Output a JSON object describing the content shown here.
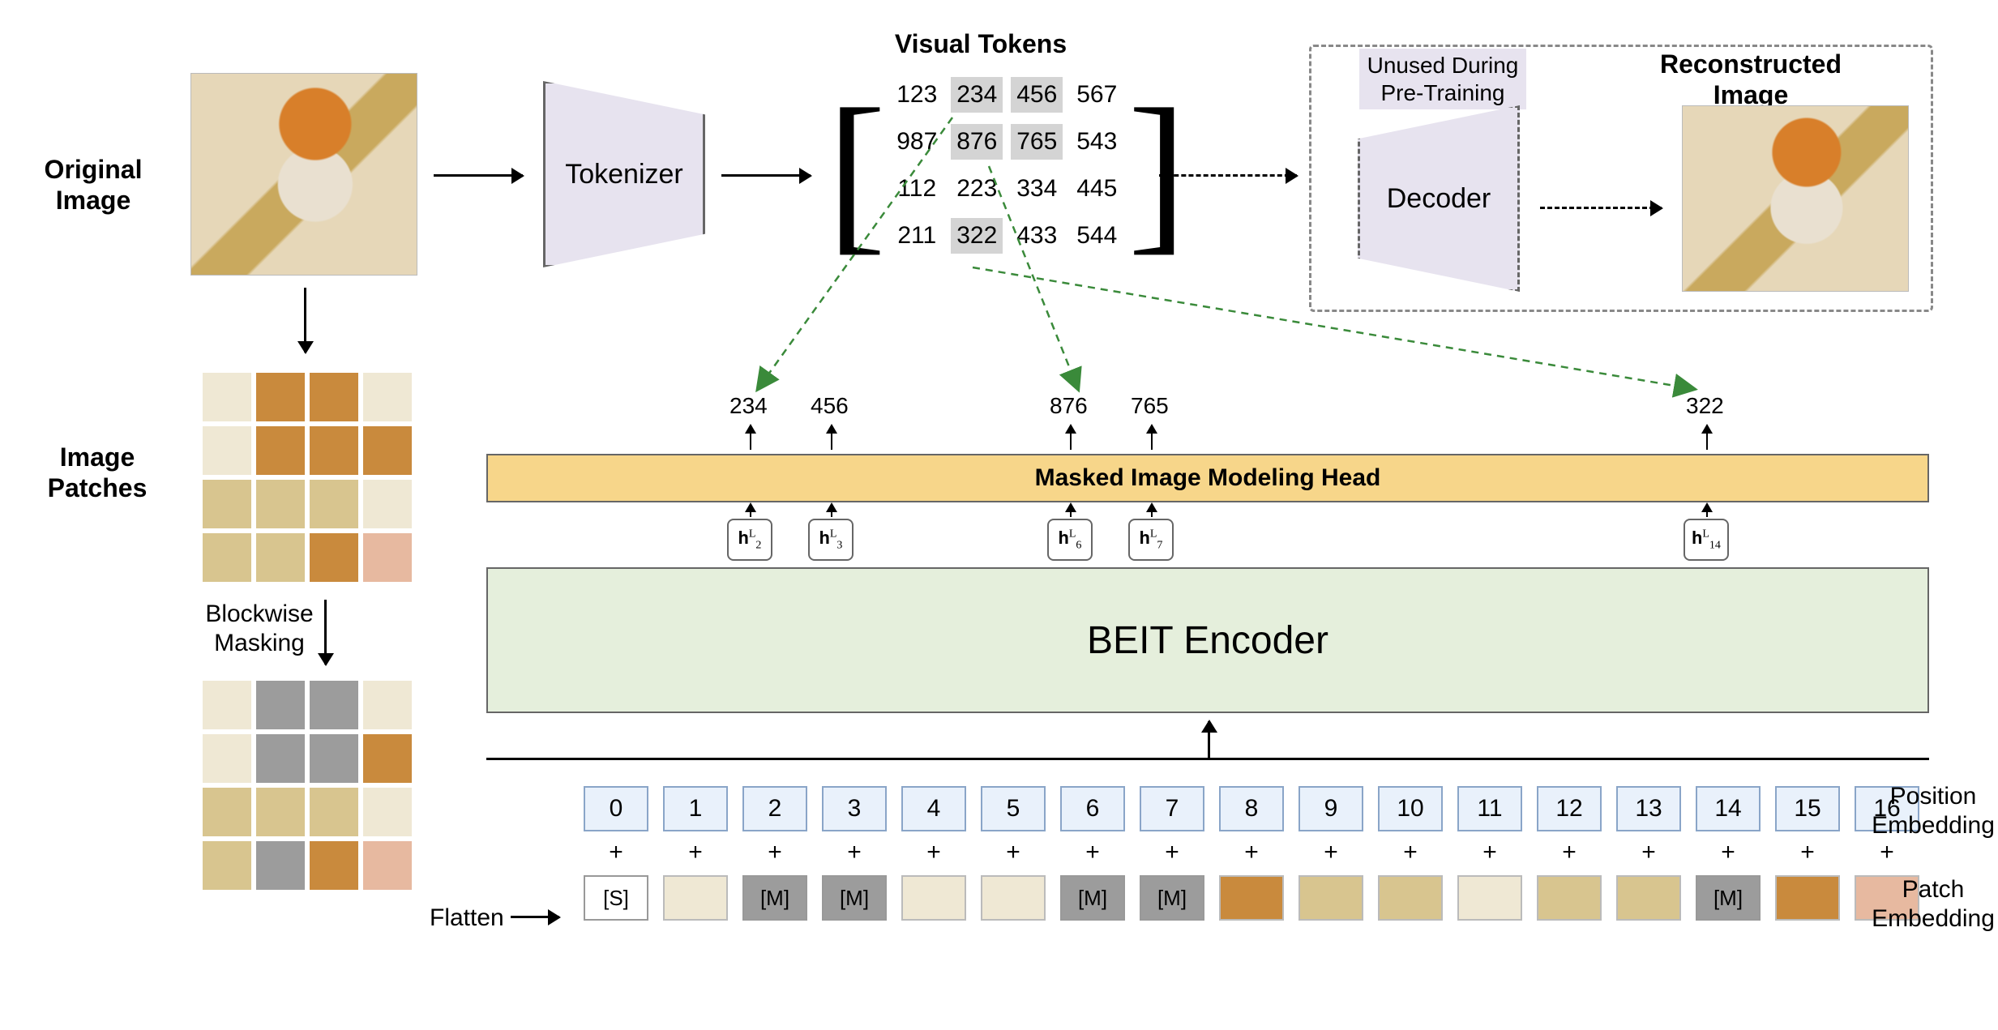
{
  "labels": {
    "original_image": "Original\nImage",
    "image_patches": "Image\nPatches",
    "blockwise_masking": "Blockwise\nMasking",
    "flatten": "Flatten",
    "tokenizer": "Tokenizer",
    "visual_tokens": "Visual Tokens",
    "unused": "Unused During\nPre-Training",
    "decoder": "Decoder",
    "reconstructed_image": "Reconstructed\nImage",
    "mim_head": "Masked Image Modeling Head",
    "encoder": "BEIT Encoder",
    "position_embedding": "Position\nEmbedding",
    "patch_embedding": "Patch\nEmbedding"
  },
  "visual_token_matrix": [
    [
      {
        "v": "123",
        "hl": false
      },
      {
        "v": "234",
        "hl": true
      },
      {
        "v": "456",
        "hl": true
      },
      {
        "v": "567",
        "hl": false
      }
    ],
    [
      {
        "v": "987",
        "hl": false
      },
      {
        "v": "876",
        "hl": true
      },
      {
        "v": "765",
        "hl": true
      },
      {
        "v": "543",
        "hl": false
      }
    ],
    [
      {
        "v": "112",
        "hl": false
      },
      {
        "v": "223",
        "hl": false
      },
      {
        "v": "334",
        "hl": false
      },
      {
        "v": "445",
        "hl": false
      }
    ],
    [
      {
        "v": "211",
        "hl": false
      },
      {
        "v": "322",
        "hl": true
      },
      {
        "v": "433",
        "hl": false
      },
      {
        "v": "544",
        "hl": false
      }
    ]
  ],
  "predicted_tokens": {
    "p0": "234",
    "p1": "456",
    "p2": "876",
    "p3": "765",
    "p4": "322"
  },
  "h_states": {
    "h0": {
      "sub": "2",
      "sup": "L"
    },
    "h1": {
      "sub": "3",
      "sup": "L"
    },
    "h2": {
      "sub": "6",
      "sup": "L"
    },
    "h3": {
      "sub": "7",
      "sup": "L"
    },
    "h4": {
      "sub": "14",
      "sup": "L"
    }
  },
  "position_embeddings": [
    "0",
    "1",
    "2",
    "3",
    "4",
    "5",
    "6",
    "7",
    "8",
    "9",
    "10",
    "11",
    "12",
    "13",
    "14",
    "15",
    "16"
  ],
  "patch_embeddings": [
    {
      "t": "[S]",
      "kind": "s"
    },
    {
      "t": "",
      "kind": "img l"
    },
    {
      "t": "[M]",
      "kind": "m"
    },
    {
      "t": "[M]",
      "kind": "m"
    },
    {
      "t": "",
      "kind": "img l"
    },
    {
      "t": "",
      "kind": "img l"
    },
    {
      "t": "[M]",
      "kind": "m"
    },
    {
      "t": "[M]",
      "kind": "m"
    },
    {
      "t": "",
      "kind": "img d"
    },
    {
      "t": "",
      "kind": "img"
    },
    {
      "t": "",
      "kind": "img"
    },
    {
      "t": "",
      "kind": "img l"
    },
    {
      "t": "",
      "kind": "img"
    },
    {
      "t": "",
      "kind": "img"
    },
    {
      "t": "[M]",
      "kind": "m"
    },
    {
      "t": "",
      "kind": "img d"
    },
    {
      "t": "",
      "kind": "img p"
    }
  ],
  "masked_grid_indices": [
    1,
    2,
    5,
    6,
    13
  ],
  "patch_grid_classes": [
    "l",
    "d",
    "d",
    "l",
    "l",
    "d",
    "d",
    "d",
    "",
    "",
    "",
    "l",
    "",
    "",
    "d",
    "p"
  ]
}
